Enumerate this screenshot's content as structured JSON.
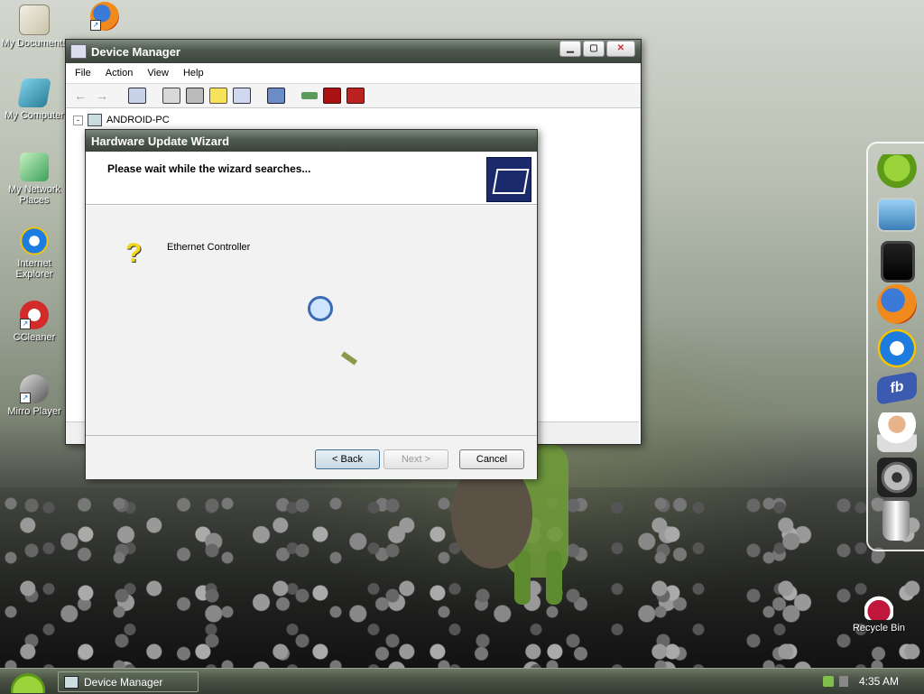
{
  "desktop": {
    "icons": [
      {
        "label": "My Documents",
        "icon": "my-documents-icon"
      },
      {
        "label": "My Computer",
        "icon": "my-computer-icon"
      },
      {
        "label": "My Network Places",
        "icon": "network-places-icon"
      },
      {
        "label": "Internet Explorer",
        "icon": "internet-explorer-icon"
      },
      {
        "label": "CCleaner",
        "icon": "ccleaner-icon"
      },
      {
        "label": "Mirro Player",
        "icon": "mirro-player-icon"
      }
    ],
    "recycle_bin": "Recycle Bin",
    "firefox_shortcut": "firefox-icon"
  },
  "dock": {
    "items": [
      "android-icon",
      "monitor-icon",
      "tablet-icon",
      "firefox-icon",
      "internet-explorer-icon",
      "facebook-icon",
      "user-support-icon",
      "gear-icon",
      "trash-icon"
    ]
  },
  "device_manager": {
    "title": "Device Manager",
    "menu": [
      "File",
      "Action",
      "View",
      "Help"
    ],
    "tree_root": "ANDROID-PC",
    "tree_expander": "-"
  },
  "wizard": {
    "title": "Hardware Update Wizard",
    "heading": "Please wait while the wizard searches...",
    "device_name": "Ethernet Controller",
    "back_label": "< Back",
    "next_label": "Next >",
    "cancel_label": "Cancel"
  },
  "taskbar": {
    "task_label": "Device Manager",
    "clock": "4:35 AM"
  },
  "colors": {
    "titlebar": "#4e594e",
    "taskbar": "#4b5446",
    "wizard_banner_icon": "#1a2a6a"
  }
}
